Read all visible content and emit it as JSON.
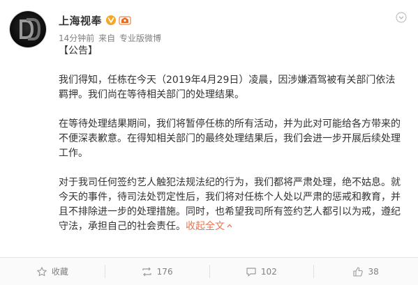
{
  "post": {
    "author": "上海视奉",
    "time": "14分钟前",
    "source_prefix": "来自",
    "source": "专业版微博",
    "heading": "【公告】",
    "paragraphs": [
      "我们得知，任栋在今天（2019年4月29日）凌晨，因涉嫌酒驾被有关部门依法羁押。我们尚在等待相关部门的处理结果。",
      "在等待处理结果期间，我们将暂停任栋的所有活动，并为此对可能给各方带来的不便深表歉意。在得知相关部门的最终处理结果后，我们会进一步开展后续处理工作。",
      "对于我司任何签约艺人触犯法规法纪的行为，我们都将严肃处理，绝不姑息。就今天的事件，待司法处罚定性后，我们将对任栋个人处以严肃的惩戒和教育，并且不排除进一步的处理措施。同时，也希望我司所有签约艺人都引以为戒，遵纪守法，承担自己的社会责任。"
    ],
    "collapse_label": "收起全文",
    "collapse_icon": "chevron-up-icon"
  },
  "actions": {
    "favorite_label": "收藏",
    "repost_count": "176",
    "comment_count": "102",
    "like_count": "38"
  },
  "colors": {
    "accent": "#eb7350",
    "verified": "#f5a623",
    "meta": "#808080"
  }
}
